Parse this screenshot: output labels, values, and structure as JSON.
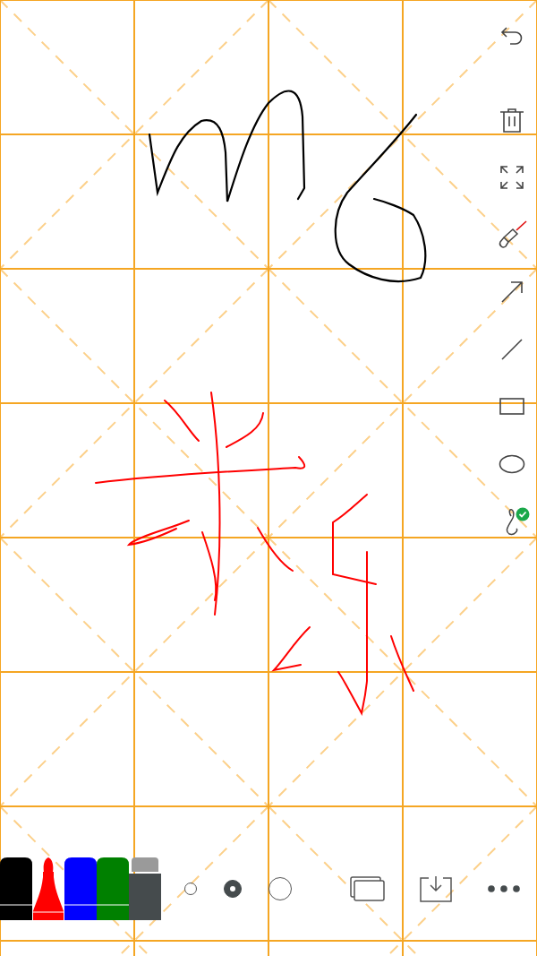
{
  "side_tools": [
    {
      "kind": "undo"
    },
    {
      "kind": "clear"
    },
    {
      "kind": "fullscreen"
    },
    {
      "kind": "laser",
      "selected": false
    },
    {
      "kind": "arrow",
      "selected": false
    },
    {
      "kind": "line",
      "selected": false
    },
    {
      "kind": "rectangle",
      "selected": false
    },
    {
      "kind": "ellipse",
      "selected": false
    },
    {
      "kind": "freehand",
      "selected": true
    }
  ],
  "pens": [
    {
      "kind": "marker",
      "color": "#000000",
      "selected": false
    },
    {
      "kind": "marker",
      "color": "#ff0000",
      "selected": true
    },
    {
      "kind": "marker",
      "color": "#0000ff",
      "selected": false
    },
    {
      "kind": "marker",
      "color": "#008000",
      "selected": false
    },
    {
      "kind": "eraser",
      "selected": false
    }
  ],
  "stroke_sizes": [
    {
      "selected": false
    },
    {
      "selected": true
    },
    {
      "selected": false
    }
  ],
  "actions": [
    {
      "kind": "layers"
    },
    {
      "kind": "save"
    },
    {
      "kind": "more"
    }
  ]
}
